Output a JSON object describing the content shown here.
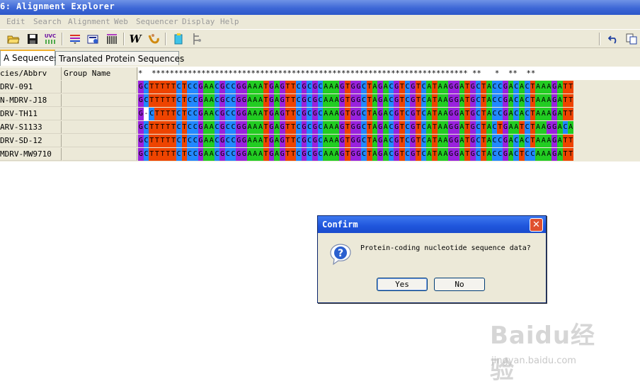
{
  "window": {
    "title": "6: Alignment Explorer"
  },
  "menu": [
    "Edit",
    "Search",
    "Alignment",
    "Web",
    "Sequencer",
    "Display",
    "Help"
  ],
  "toolbar": {
    "icons": [
      "open-icon",
      "save-icon",
      "uvc-icon",
      "align-bars-icon",
      "align-settings-icon",
      "codon-bars-icon",
      "w-icon",
      "muscle-icon",
      "copy-seq-icon",
      "mark-icon",
      "undo-icon",
      "paste-icon"
    ],
    "w_label": "W",
    "uvc_label": "UVC"
  },
  "tabs": {
    "dna": "A Sequences",
    "protein": "Translated Protein Sequences"
  },
  "grid": {
    "headers": {
      "species": "cies/Abbrv",
      "group": "Group Name"
    },
    "consensus": "*  ********************************************************************** **   *  **  **  ",
    "rows": [
      {
        "name": "DRV-091",
        "seq": "GCTTTTTCTCCGAACGCCGGAAATGAGTTCGCGCAAAGTGGCTAGACGTCGTCATAAGGATGCTACCGACACTAAAGATT"
      },
      {
        "name": "N-MDRV-J18",
        "seq": "GCTTTTTCTCCGAACGCCGGAAATGAGTTCGCGCAAAGTGGCTAGACGTCGTCATAAGGATGCTACCGACACTAAAGATT"
      },
      {
        "name": "DRV-TH11",
        "seq": "G-CTTTTCTCCGAACGCCGGAAATGAGTTCGCGCAAAGTGGCTAGACGTCGTCATAAGGATGCTACCGACACTAAAGATT"
      },
      {
        "name": "ARV-S1133",
        "seq": "GCTTTTTCTCCGAACGCCGGAAATGAGTTCGCGCAAAGTGGCTAGACGTCGTCATAAGGATGCTACTGAATCTAAGGACA"
      },
      {
        "name": "DRV-SD-12",
        "seq": "GCTTTTTCTCCGAACGCCGGAAATGAGTTCGCGCAAAGTGGCTAGACGTCGTCATAAGGATGCTACCGACACTAAAGATT"
      },
      {
        "name": "MDRV-MW9710",
        "seq": "GCTTTTTCTCCGAACGCCGGAAATGAGTTCGCGCAAAGTGGCTAGACGTCGTCATAAGGATGCTACCGACTCCAAAGATT"
      }
    ]
  },
  "dialog": {
    "title": "Confirm",
    "message": "Protein-coding nucleotide sequence data?",
    "yes": "Yes",
    "no": "No",
    "icon": "question-icon"
  },
  "watermark": {
    "logo": "Baidu经验",
    "url": "jingyan.baidu.com"
  }
}
